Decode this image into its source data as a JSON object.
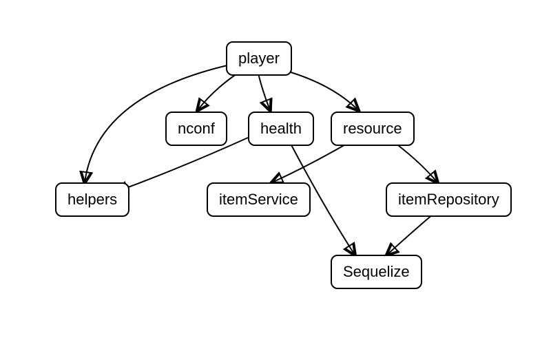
{
  "diagram": {
    "nodes": {
      "player": "player",
      "nconf": "nconf",
      "health": "health",
      "resource": "resource",
      "helpers": "helpers",
      "itemService": "itemService",
      "itemRepository": "itemRepository",
      "sequelize": "Sequelize"
    },
    "edges": [
      {
        "from": "player",
        "to": "nconf"
      },
      {
        "from": "player",
        "to": "health"
      },
      {
        "from": "player",
        "to": "resource"
      },
      {
        "from": "player",
        "to": "helpers"
      },
      {
        "from": "health",
        "to": "helpers"
      },
      {
        "from": "health",
        "to": "Sequelize"
      },
      {
        "from": "resource",
        "to": "itemService"
      },
      {
        "from": "resource",
        "to": "itemRepository"
      },
      {
        "from": "itemRepository",
        "to": "Sequelize"
      }
    ]
  }
}
